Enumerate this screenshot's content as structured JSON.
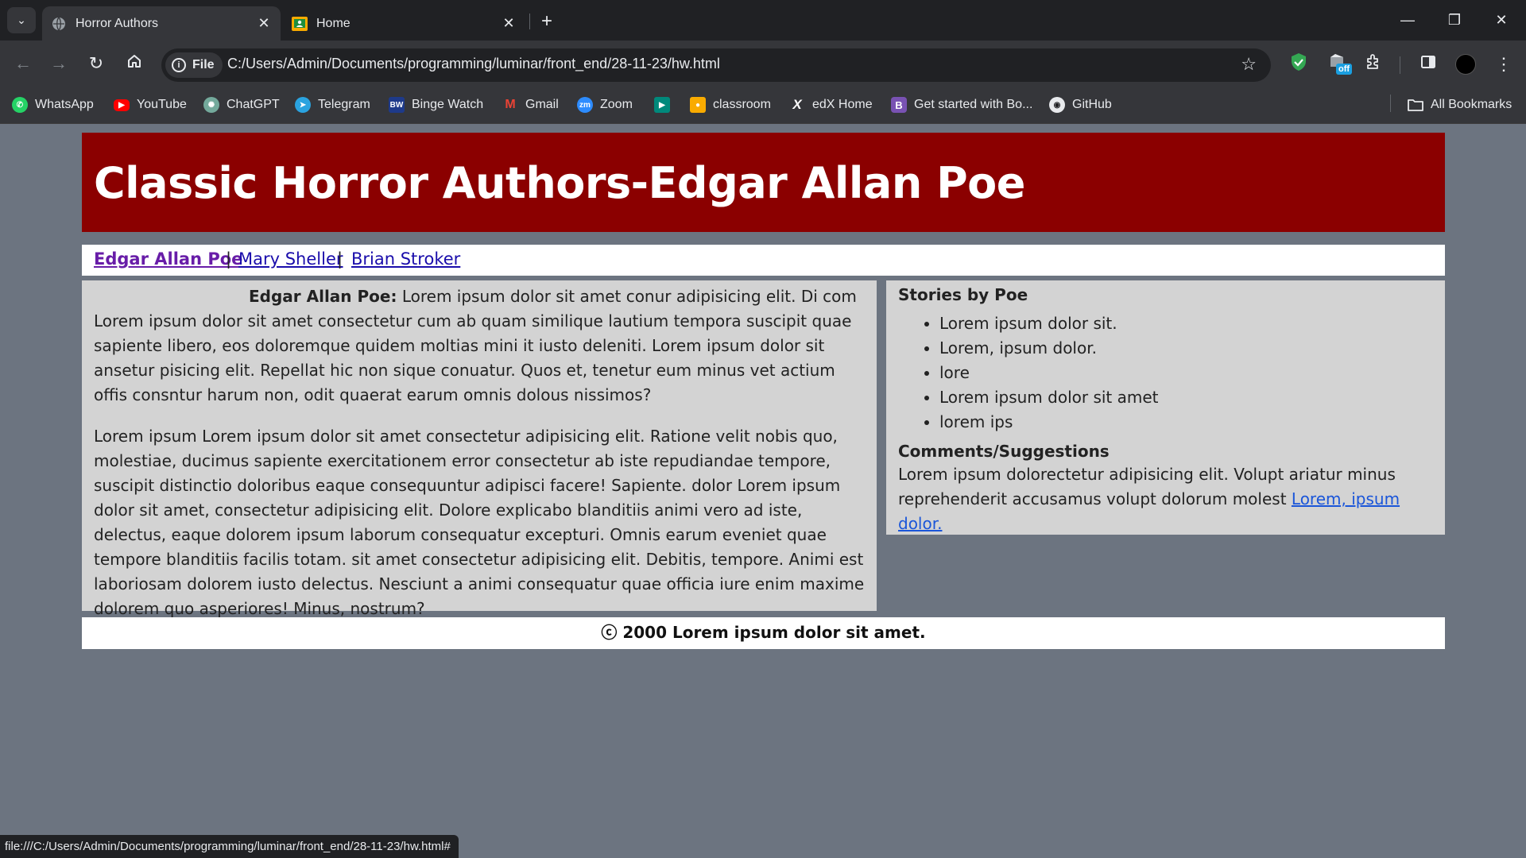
{
  "browser": {
    "tabs": [
      {
        "title": "Horror Authors",
        "active": true,
        "icon": "globe-icon"
      },
      {
        "title": "Home",
        "active": false,
        "icon": "classroom-icon"
      }
    ],
    "site_chip": "File",
    "url": "C:/Users/Admin/Documents/programming/luminar/front_end/28-11-23/hw.html",
    "extension_badge": "off",
    "bookmarks": [
      {
        "label": "WhatsApp",
        "icon": "whatsapp-icon",
        "color": "#25d366"
      },
      {
        "label": "YouTube",
        "icon": "youtube-icon",
        "color": "#ff0000"
      },
      {
        "label": "ChatGPT",
        "icon": "chatgpt-icon",
        "color": "#74aa9c"
      },
      {
        "label": "Telegram",
        "icon": "telegram-icon",
        "color": "#2aa3e0"
      },
      {
        "label": "Binge Watch",
        "icon": "bw-icon",
        "color": "#1e3a8a"
      },
      {
        "label": "Gmail",
        "icon": "gmail-icon",
        "color": "#ea4335"
      },
      {
        "label": "Zoom",
        "icon": "zoom-icon",
        "color": "#2d8cff"
      },
      {
        "label": "",
        "icon": "meet-icon",
        "color": "#00897b"
      },
      {
        "label": "classroom",
        "icon": "classroom-icon",
        "color": "#f9ab00"
      },
      {
        "label": "edX Home",
        "icon": "edx-icon",
        "color": "#111111"
      },
      {
        "label": "Get started with Bo...",
        "icon": "bootstrap-icon",
        "color": "#7952b3"
      },
      {
        "label": "GitHub",
        "icon": "github-icon",
        "color": "#e8eaed"
      }
    ],
    "all_bookmarks": "All Bookmarks",
    "status_url": "file:///C:/Users/Admin/Documents/programming/luminar/front_end/28-11-23/hw.html#"
  },
  "page": {
    "header_title": "Classic Horror Authors-Edgar Allan Poe",
    "nav": {
      "links": [
        "Edgar Allan Poe",
        "Mary Sheller",
        "Brian Stroker"
      ],
      "separator": "|"
    },
    "main": {
      "lead_label": "Edgar Allan Poe:",
      "paragraph1": " Lorem ipsum dolor sit amet conur adipisicing elit. Di com Lorem ipsum dolor sit amet consectetur cum ab quam similique lautium tempora suscipit quae sapiente libero, eos doloremque quidem moltias mini it iusto deleniti. Lorem ipsum dolor sit ansetur pisicing elit. Repellat hic non sique conuatur. Quos et, tenetur eum minus vet actium offis consntur harum non, odit quaerat earum omnis dolous nissimos?",
      "paragraph2": "Lorem ipsum Lorem ipsum dolor sit amet consectetur adipisicing elit. Ratione velit nobis quo, molestiae, ducimus sapiente exercitationem error consectetur ab iste repudiandae tempore, suscipit distinctio doloribus eaque consequuntur adipisci facere! Sapiente. dolor Lorem ipsum dolor sit amet, consectetur adipisicing elit. Dolore explicabo blanditiis animi vero ad iste, delectus, eaque dolorem ipsum laborum consequatur excepturi. Omnis earum eveniet quae tempore blanditiis facilis totam. sit amet consectetur adipisicing elit. Debitis, tempore. Animi est laboriosam dolorem iusto delectus. Nesciunt a animi consequatur quae officia iure enim maxime dolorem quo asperiores! Minus, nostrum?"
    },
    "sidebar": {
      "stories_heading": "Stories by Poe",
      "stories": [
        "Lorem ipsum dolor sit.",
        "Lorem, ipsum dolor.",
        "lore",
        "Lorem ipsum dolor sit amet",
        "lorem ips"
      ],
      "comments_heading": "Comments/Suggestions",
      "comments_text": "Lorem ipsum dolorectetur adipisicing elit. Volupt ariatur minus reprehenderit accusamus volupt dolorum molest ",
      "comments_link": "Lorem, ipsum dolor."
    },
    "footer": "ⓒ 2000 Lorem ipsum dolor sit amet.",
    "colors": {
      "header_bg": "#8b0000",
      "page_bg": "#6c7480",
      "panel_bg": "#d3d3d3"
    }
  }
}
